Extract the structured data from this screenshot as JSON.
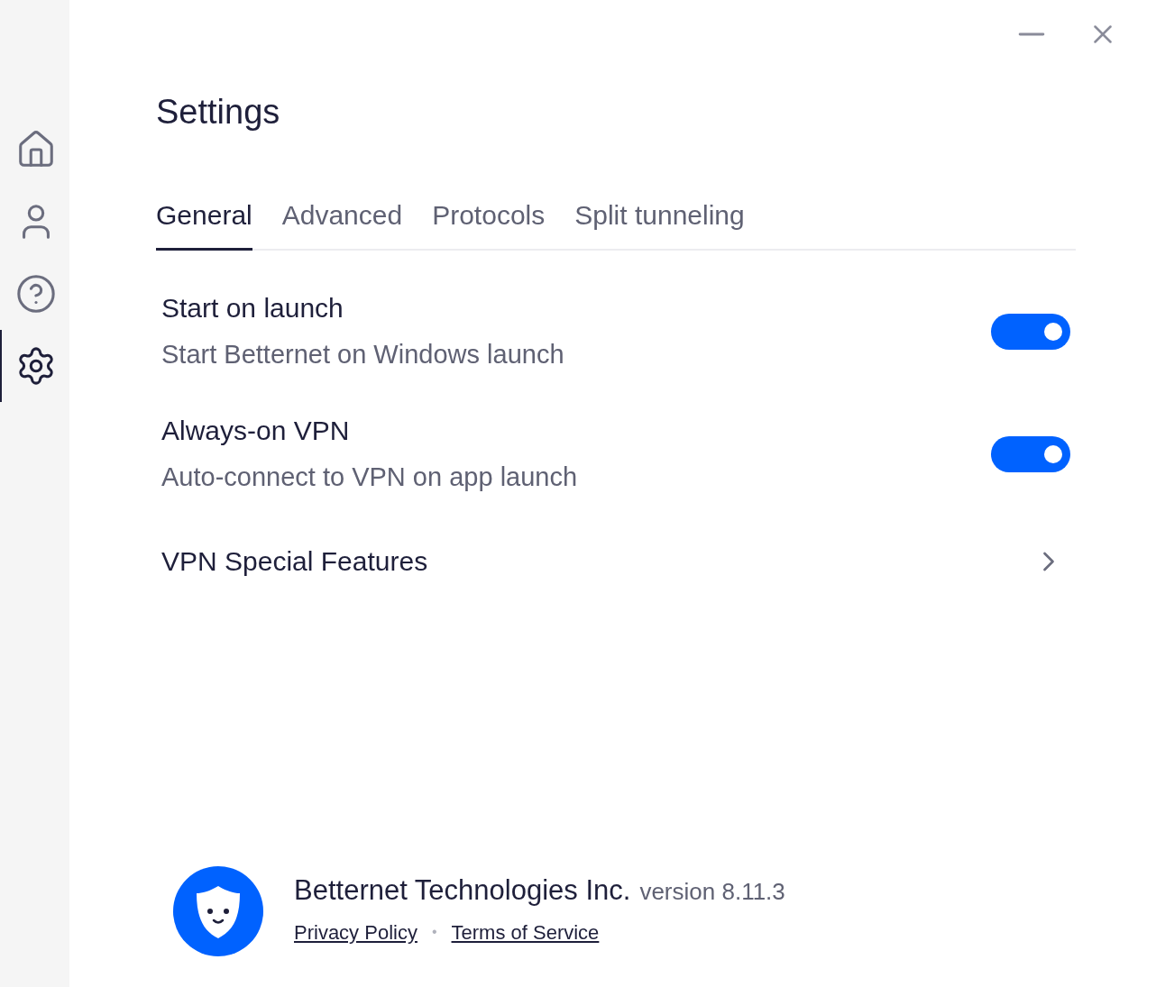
{
  "sidebar": {
    "items": [
      {
        "kind": "home",
        "selected": false
      },
      {
        "kind": "account",
        "selected": false
      },
      {
        "kind": "help",
        "selected": false
      },
      {
        "kind": "settings",
        "selected": true
      }
    ]
  },
  "title": "Settings",
  "tabs": [
    {
      "label": "General",
      "selected": true
    },
    {
      "label": "Advanced",
      "selected": false
    },
    {
      "label": "Protocols",
      "selected": false
    },
    {
      "label": "Split tunneling",
      "selected": false
    }
  ],
  "settings": [
    {
      "kind": "toggle",
      "title": "Start on launch",
      "description": "Start Betternet on Windows launch",
      "on": true
    },
    {
      "kind": "toggle",
      "title": "Always-on VPN",
      "description": "Auto-connect to VPN on app launch",
      "on": true
    },
    {
      "kind": "link",
      "title": "VPN Special Features"
    }
  ],
  "footer": {
    "company": "Betternet Technologies Inc.",
    "version": "version 8.11.3",
    "links": [
      "Privacy Policy",
      "Terms of Service"
    ],
    "separator": "•"
  }
}
